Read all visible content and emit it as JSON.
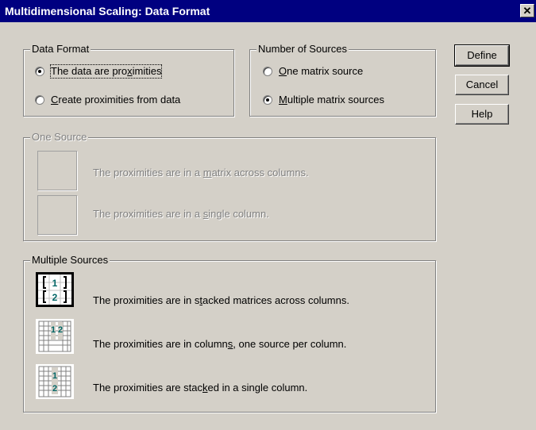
{
  "window": {
    "title": "Multidimensional Scaling: Data Format",
    "close_glyph": "✕"
  },
  "data_format": {
    "legend": "Data Format",
    "options": [
      {
        "pre": "The data are pro",
        "key": "x",
        "post": "imities",
        "checked": true
      },
      {
        "pre": "",
        "key": "C",
        "post": "reate proximities from data",
        "checked": false
      }
    ]
  },
  "number_of_sources": {
    "legend": "Number of Sources",
    "options": [
      {
        "pre": "",
        "key": "O",
        "post": "ne matrix source",
        "checked": false
      },
      {
        "pre": "",
        "key": "M",
        "post": "ultiple matrix sources",
        "checked": true
      }
    ]
  },
  "buttons": {
    "define": "Define",
    "cancel": "Cancel",
    "help": "Help"
  },
  "one_source": {
    "legend": "One Source",
    "options": [
      {
        "pre": "The proximities are in a ",
        "key": "m",
        "post": "atrix across columns."
      },
      {
        "pre": "The proximities are in a ",
        "key": "s",
        "post": "ingle column."
      }
    ]
  },
  "multiple_sources": {
    "legend": "Multiple Sources",
    "options": [
      {
        "pre": "The proximities are in s",
        "key": "t",
        "post": "acked matrices across columns.",
        "selected": true,
        "icon": "stacked-matrices-icon"
      },
      {
        "pre": "The proximities are in column",
        "key": "s",
        "post": ", one source per column.",
        "selected": false,
        "icon": "columns-per-source-icon"
      },
      {
        "pre": "The proximities are stac",
        "key": "k",
        "post": "ed in a single column.",
        "selected": false,
        "icon": "stacked-single-column-icon"
      }
    ],
    "icon_digits": [
      "1",
      "2"
    ]
  },
  "colors": {
    "title_bar": "#000080",
    "face": "#d4d0c8",
    "disabled": "#808080",
    "icon_number": "#006666"
  }
}
